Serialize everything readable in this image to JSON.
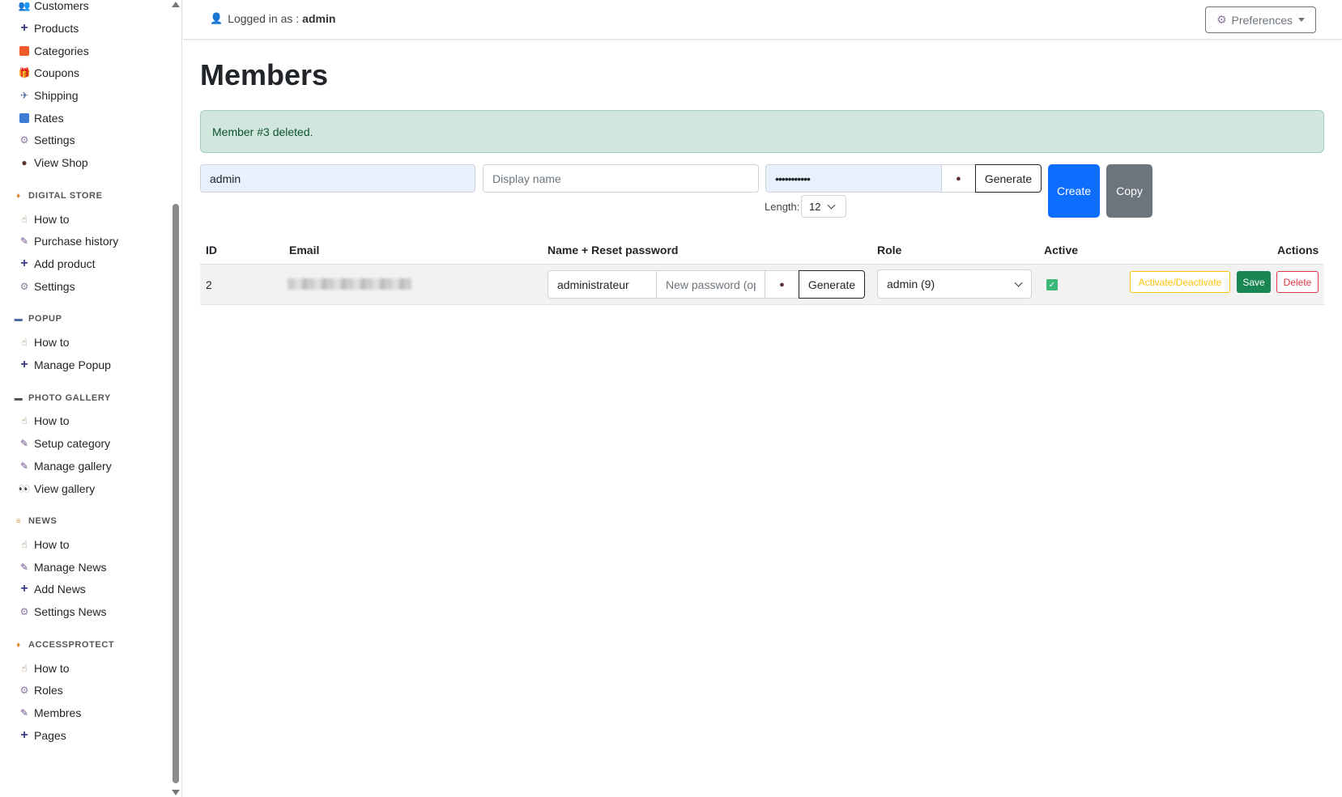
{
  "sidebar": {
    "items_top": [
      {
        "label": "Customers",
        "icon": "people-icon"
      },
      {
        "label": "Products",
        "icon": "plus-icon"
      },
      {
        "label": "Categories",
        "icon": "square-icon"
      },
      {
        "label": "Coupons",
        "icon": "gift-icon"
      },
      {
        "label": "Shipping",
        "icon": "plane-icon"
      },
      {
        "label": "Rates",
        "icon": "chart-icon"
      },
      {
        "label": "Settings",
        "icon": "gear-icon"
      },
      {
        "label": "View Shop",
        "icon": "eye-icon"
      }
    ],
    "digital_store": {
      "title": "DIGITAL STORE",
      "items": [
        "How to",
        "Purchase history",
        "Add product",
        "Settings"
      ]
    },
    "popup": {
      "title": "POPUP",
      "items": [
        "How to",
        "Manage Popup"
      ]
    },
    "photo_gallery": {
      "title": "PHOTO GALLERY",
      "items": [
        "How to",
        "Setup category",
        "Manage gallery",
        "View gallery"
      ]
    },
    "news": {
      "title": "NEWS",
      "items": [
        "How to",
        "Manage News",
        "Add News",
        "Settings News"
      ]
    },
    "accessprotect": {
      "title": "ACCESSPROTECT",
      "items": [
        "How to",
        "Roles",
        "Membres",
        "Pages"
      ]
    }
  },
  "topbar": {
    "logged_prefix": "Logged in as :",
    "username": "admin",
    "preferences_label": "Preferences"
  },
  "page": {
    "title": "Members",
    "alert": "Member #3 deleted."
  },
  "create_form": {
    "email_value": "admin",
    "display_name_placeholder": "Display name",
    "password_value": "•••••••••••",
    "generate_label": "Generate",
    "length_label": "Length:",
    "length_value": "12",
    "create_label": "Create",
    "copy_label": "Copy"
  },
  "table": {
    "headers": {
      "id": "ID",
      "email": "Email",
      "name": "Name + Reset password",
      "role": "Role",
      "active": "Active",
      "actions": "Actions"
    },
    "rows": [
      {
        "id": "2",
        "name_value": "administrateur",
        "new_password_placeholder": "New password (optional)",
        "generate_label": "Generate",
        "role": "admin (9)",
        "active": true,
        "activate_label": "Activate/Deactivate",
        "save_label": "Save",
        "delete_label": "Delete"
      }
    ]
  },
  "colors": {
    "primary": "#0d6efd",
    "secondary": "#6c757d",
    "success": "#198754",
    "warning": "#ffc107",
    "danger": "#dc3545",
    "alert_bg": "#d1e7dd"
  }
}
